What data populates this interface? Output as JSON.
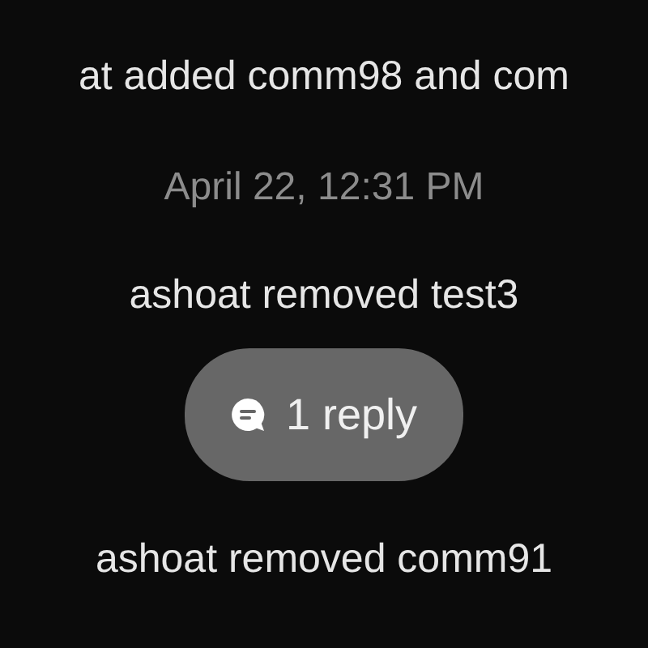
{
  "messages": [
    {
      "kind": "event",
      "text": "at added comm98 and com"
    },
    {
      "kind": "time",
      "text": "April 22, 12:31 PM"
    },
    {
      "kind": "event",
      "text": "ashoat removed test3"
    },
    {
      "kind": "replies",
      "text": "1 reply"
    },
    {
      "kind": "event",
      "text": "ashoat removed comm91"
    }
  ]
}
